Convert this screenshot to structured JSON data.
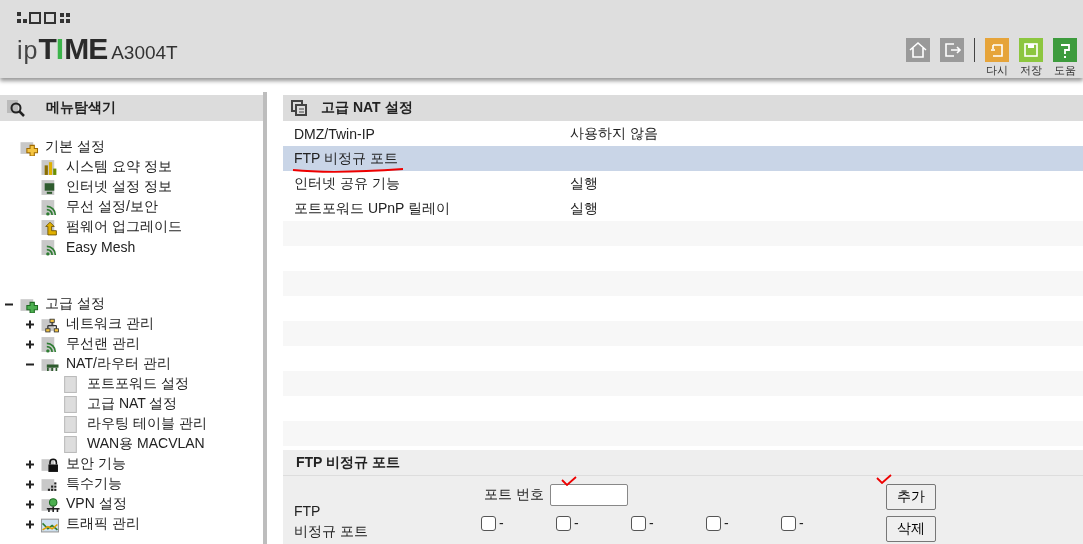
{
  "logo": [
    {
      "text": "ip",
      "kind": "light"
    },
    {
      "text": "T",
      "kind": "bold"
    },
    {
      "text": "I",
      "kind": "accent"
    },
    {
      "text": "ME",
      "kind": "bold"
    },
    {
      "text": "A3004T",
      "kind": "model"
    }
  ],
  "toolbar": [
    {
      "kind": "home"
    },
    {
      "kind": "logout"
    },
    {
      "kind": "undo",
      "label": "다시"
    },
    {
      "kind": "save",
      "label": "저장"
    },
    {
      "kind": "help",
      "label": "도움"
    }
  ],
  "sidebar": {
    "title": "메뉴탐색기",
    "tree": [
      {
        "label": "기본 설정",
        "kind": "folder-plus",
        "children": [
          {
            "label": "시스템 요약 정보",
            "kind": "chart"
          },
          {
            "label": "인터넷 설정 정보",
            "kind": "monitor"
          },
          {
            "label": "무선 설정/보안",
            "kind": "wifi"
          },
          {
            "label": "펌웨어 업그레이드",
            "kind": "upload"
          },
          {
            "label": "Easy Mesh",
            "kind": "wifi"
          }
        ]
      },
      {
        "label": "고급 설정",
        "kind": "folder-cross",
        "expanded": true,
        "children": [
          {
            "label": "네트워크 관리",
            "kind": "network",
            "expanded": false
          },
          {
            "label": "무선랜 관리",
            "kind": "wifi",
            "expanded": false
          },
          {
            "label": "NAT/라우터 관리",
            "kind": "router",
            "expanded": true,
            "children": [
              {
                "label": "포트포워드 설정",
                "kind": "page"
              },
              {
                "label": "고급 NAT 설정",
                "kind": "page"
              },
              {
                "label": "라우팅 테이블 관리",
                "kind": "page"
              },
              {
                "label": "WAN용 MACVLAN",
                "kind": "page"
              }
            ]
          },
          {
            "label": "보안 기능",
            "kind": "lock",
            "expanded": false
          },
          {
            "label": "특수기능",
            "kind": "dots",
            "expanded": false
          },
          {
            "label": "VPN 설정",
            "kind": "vpn",
            "expanded": false
          },
          {
            "label": "트래픽 관리",
            "kind": "traffic",
            "expanded": false
          }
        ]
      }
    ]
  },
  "main": {
    "title": "고급 NAT 설정",
    "rows": [
      {
        "name": "DMZ/Twin-IP",
        "value": "사용하지 않음",
        "selected": false
      },
      {
        "name": "FTP 비정규 포트",
        "selected": true
      },
      {
        "name": "인터넷 공유 기능",
        "value": "실행",
        "selected": false
      },
      {
        "name": "포트포워드 UPnP 릴레이",
        "value": "실행",
        "selected": false
      }
    ]
  },
  "ftp_panel": {
    "title": "FTP 비정규 포트",
    "label": "FTP\n비정규 포트",
    "port_label": "포트 번호",
    "ports": [
      {
        "value": "-",
        "checked": false
      },
      {
        "value": "-",
        "checked": false
      },
      {
        "value": "-",
        "checked": false
      },
      {
        "value": "-",
        "checked": false
      },
      {
        "value": "-",
        "checked": false
      }
    ],
    "buttons": [
      "추가",
      "삭제"
    ]
  }
}
